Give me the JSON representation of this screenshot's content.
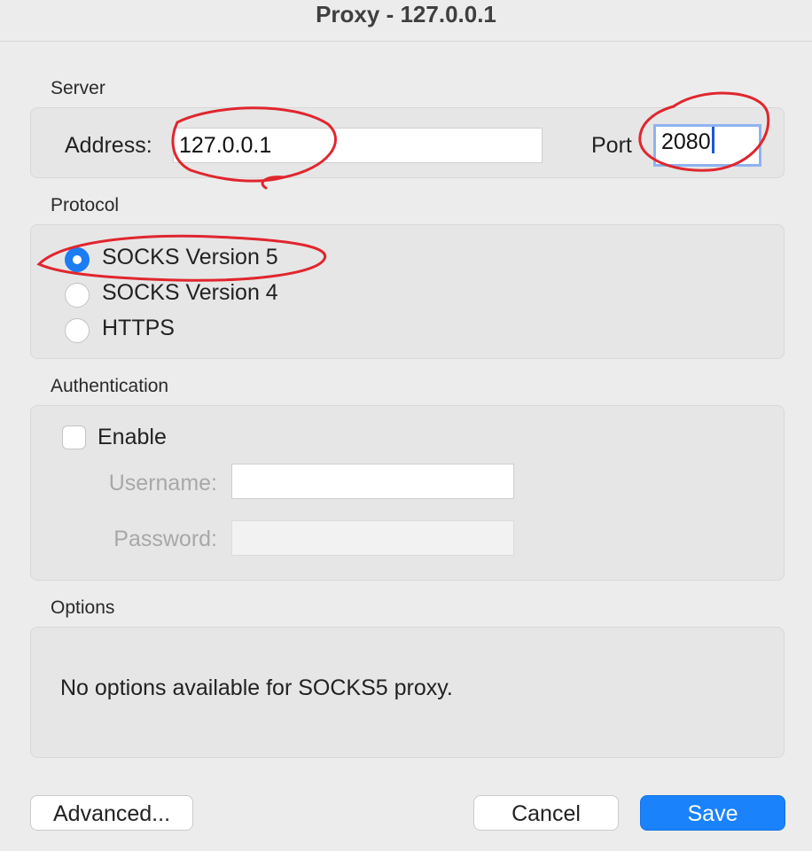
{
  "window": {
    "title": "Proxy - 127.0.0.1"
  },
  "server": {
    "section_label": "Server",
    "address_label": "Address:",
    "address_value": "127.0.0.1",
    "port_label": "Port",
    "port_value": "2080"
  },
  "protocol": {
    "section_label": "Protocol",
    "options": [
      {
        "label": "SOCKS Version 5",
        "selected": true
      },
      {
        "label": "SOCKS Version 4",
        "selected": false
      },
      {
        "label": "HTTPS",
        "selected": false
      }
    ]
  },
  "authentication": {
    "section_label": "Authentication",
    "enable_label": "Enable",
    "enable_checked": false,
    "username_label": "Username:",
    "username_value": "",
    "password_label": "Password:",
    "password_value": ""
  },
  "options": {
    "section_label": "Options",
    "message": "No options available for SOCKS5 proxy."
  },
  "buttons": {
    "advanced": "Advanced...",
    "cancel": "Cancel",
    "save": "Save"
  },
  "colors": {
    "accent": "#1a82fb",
    "annotation": "#e0262e",
    "background": "#ececec"
  }
}
